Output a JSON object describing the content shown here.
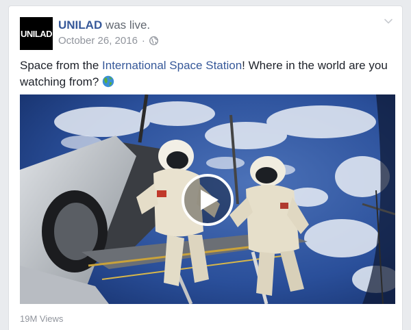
{
  "post": {
    "avatar_text": "UNILAD",
    "author": "UNILAD",
    "status": "was live.",
    "date": "October 26, 2016",
    "separator": "·",
    "privacy_icon": "globe-icon",
    "options_icon": "chevron-down-icon",
    "text_before": "Space from the ",
    "text_link": "International Space Station",
    "text_after": "! Where in the world are you watching from?",
    "emoji_icon": "earth-globe-americas-icon",
    "video_icon": "play-icon",
    "views": "19M Views"
  },
  "colors": {
    "link": "#365899",
    "meta": "#90949c",
    "text": "#1d2129",
    "card_border": "#dddfe2",
    "background": "#e9ebee"
  }
}
